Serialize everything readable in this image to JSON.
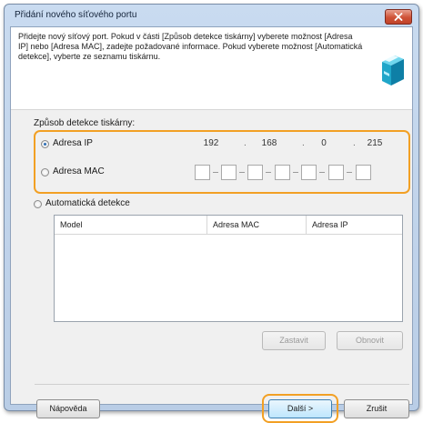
{
  "window": {
    "title": "Přidání nového síťového portu"
  },
  "intro_text": "Přidejte nový síťový port. Pokud v části [Způsob detekce tiskárny] vyberete možnost [Adresa IP] nebo [Adresa MAC], zadejte požadované informace. Pokud vyberete možnost [Automatická detekce], vyberte ze seznamu tiskárnu.",
  "detection": {
    "group_label": "Způsob detekce tiskárny:",
    "ip": {
      "label": "Adresa IP",
      "selected": true,
      "octets": [
        "192",
        "168",
        "0",
        "215"
      ]
    },
    "mac": {
      "label": "Adresa MAC",
      "selected": false
    },
    "auto": {
      "label": "Automatická detekce",
      "selected": false
    }
  },
  "table": {
    "columns": [
      "Model",
      "Adresa MAC",
      "Adresa IP"
    ]
  },
  "buttons": {
    "stop": "Zastavit",
    "refresh": "Obnovit",
    "help": "Nápověda",
    "next": "Další >",
    "cancel": "Zrušit"
  },
  "colors": {
    "highlight": "#f2a024",
    "selected_radio": "#2e6fb5",
    "title_bar": "#c9dbf0"
  },
  "icons": {
    "printer": "printer-icon",
    "close": "close-icon"
  }
}
